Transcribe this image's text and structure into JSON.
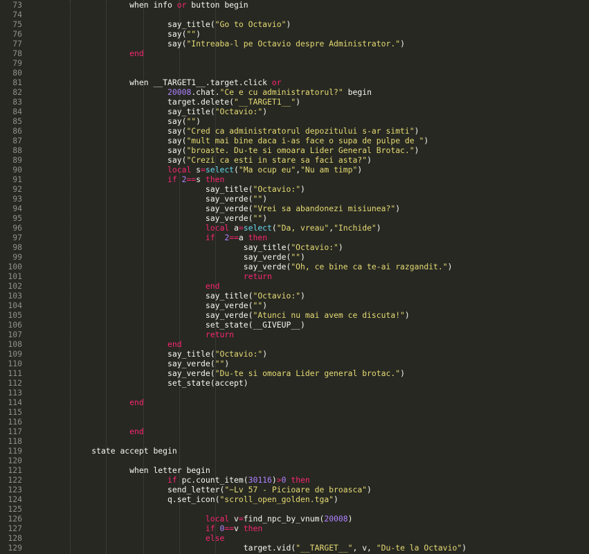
{
  "editor": {
    "lines": [
      {
        "n": "73",
        "t": [
          [
            "",
            "                    when info "
          ],
          [
            "kw",
            "or"
          ],
          [
            "",
            " button begin"
          ]
        ]
      },
      {
        "n": "74",
        "t": []
      },
      {
        "n": "75",
        "t": [
          [
            "",
            "                            say_title("
          ],
          [
            "str",
            "\"Go to Octavio\""
          ],
          [
            "",
            ")"
          ]
        ]
      },
      {
        "n": "76",
        "t": [
          [
            "",
            "                            say("
          ],
          [
            "str",
            "\"\""
          ],
          [
            "",
            ")"
          ]
        ]
      },
      {
        "n": "77",
        "t": [
          [
            "",
            "                            say("
          ],
          [
            "str",
            "\"Intreaba-l pe Octavio despre Administrator.\""
          ],
          [
            "",
            ")"
          ]
        ]
      },
      {
        "n": "78",
        "t": [
          [
            "kw",
            "                    end"
          ]
        ]
      },
      {
        "n": "79",
        "t": []
      },
      {
        "n": "80",
        "t": []
      },
      {
        "n": "81",
        "t": [
          [
            "",
            "                    when __TARGET1__.target.click "
          ],
          [
            "kw",
            "or"
          ]
        ]
      },
      {
        "n": "82",
        "t": [
          [
            "num",
            "                            20008"
          ],
          [
            "",
            ".chat."
          ],
          [
            "str",
            "\"Ce e cu administratorul?\""
          ],
          [
            "",
            " begin"
          ]
        ]
      },
      {
        "n": "83",
        "t": [
          [
            "",
            "                            target.delete("
          ],
          [
            "str",
            "\"__TARGET1__\""
          ],
          [
            "",
            ")"
          ]
        ]
      },
      {
        "n": "84",
        "t": [
          [
            "",
            "                            say_title("
          ],
          [
            "str",
            "\"Octavio:\""
          ],
          [
            "",
            ")"
          ]
        ]
      },
      {
        "n": "85",
        "t": [
          [
            "",
            "                            say("
          ],
          [
            "str",
            "\"\""
          ],
          [
            "",
            ")"
          ]
        ]
      },
      {
        "n": "86",
        "t": [
          [
            "",
            "                            say("
          ],
          [
            "str",
            "\"Cred ca administratorul depozitului s-ar simti\""
          ],
          [
            "",
            ")"
          ]
        ]
      },
      {
        "n": "87",
        "t": [
          [
            "",
            "                            say("
          ],
          [
            "str",
            "\"mult mai bine daca i-as face o supa de pulpe de \""
          ],
          [
            "",
            ")"
          ]
        ]
      },
      {
        "n": "88",
        "t": [
          [
            "",
            "                            say("
          ],
          [
            "str",
            "\"broaste. Du-te si omoara Lider General Brotac.\""
          ],
          [
            "",
            ")"
          ]
        ]
      },
      {
        "n": "89",
        "t": [
          [
            "",
            "                            say("
          ],
          [
            "str",
            "\"Crezi ca esti in stare sa faci asta?\""
          ],
          [
            "",
            ")"
          ]
        ]
      },
      {
        "n": "90",
        "t": [
          [
            "kw",
            "                            local"
          ],
          [
            "",
            " s"
          ],
          [
            "kw",
            "="
          ],
          [
            "fn",
            "select"
          ],
          [
            "",
            "("
          ],
          [
            "str",
            "\"Ma ocup eu\""
          ],
          [
            "",
            ","
          ],
          [
            "str",
            "\"Nu am timp\""
          ],
          [
            "",
            ")"
          ]
        ]
      },
      {
        "n": "91",
        "t": [
          [
            "kw",
            "                            if"
          ],
          [
            "",
            " "
          ],
          [
            "num",
            "2"
          ],
          [
            "kw",
            "=="
          ],
          [
            "",
            "s "
          ],
          [
            "kw",
            "then"
          ]
        ]
      },
      {
        "n": "92",
        "t": [
          [
            "",
            "                                    say_title("
          ],
          [
            "str",
            "\"Octavio:\""
          ],
          [
            "",
            ")"
          ]
        ]
      },
      {
        "n": "93",
        "t": [
          [
            "",
            "                                    say_verde("
          ],
          [
            "str",
            "\"\""
          ],
          [
            "",
            ")"
          ]
        ]
      },
      {
        "n": "94",
        "t": [
          [
            "",
            "                                    say_verde("
          ],
          [
            "str",
            "\"Vrei sa abandonezi misiunea?\""
          ],
          [
            "",
            ")"
          ]
        ]
      },
      {
        "n": "95",
        "t": [
          [
            "",
            "                                    say_verde("
          ],
          [
            "str",
            "\"\""
          ],
          [
            "",
            ")"
          ]
        ]
      },
      {
        "n": "96",
        "t": [
          [
            "kw",
            "                                    local"
          ],
          [
            "",
            " a"
          ],
          [
            "kw",
            "="
          ],
          [
            "fn",
            "select"
          ],
          [
            "",
            "("
          ],
          [
            "str",
            "\"Da, vreau\""
          ],
          [
            "",
            ","
          ],
          [
            "str",
            "\"Inchide\""
          ],
          [
            "",
            ")"
          ]
        ]
      },
      {
        "n": "97",
        "t": [
          [
            "kw",
            "                                    if"
          ],
          [
            "",
            "  "
          ],
          [
            "num",
            "2"
          ],
          [
            "kw",
            "=="
          ],
          [
            "",
            "a "
          ],
          [
            "kw",
            "then"
          ]
        ]
      },
      {
        "n": "98",
        "t": [
          [
            "",
            "                                            say_title("
          ],
          [
            "str",
            "\"Octavio:\""
          ],
          [
            "",
            ")"
          ]
        ]
      },
      {
        "n": "99",
        "t": [
          [
            "",
            "                                            say_verde("
          ],
          [
            "str",
            "\"\""
          ],
          [
            "",
            ")"
          ]
        ]
      },
      {
        "n": "100",
        "t": [
          [
            "",
            "                                            say_verde("
          ],
          [
            "str",
            "\"Oh, ce bine ca te-ai razgandit.\""
          ],
          [
            "",
            ")"
          ]
        ]
      },
      {
        "n": "101",
        "t": [
          [
            "kw",
            "                                            return"
          ]
        ]
      },
      {
        "n": "102",
        "t": [
          [
            "kw",
            "                                    end"
          ]
        ]
      },
      {
        "n": "103",
        "t": [
          [
            "",
            "                                    say_title("
          ],
          [
            "str",
            "\"Octavio:\""
          ],
          [
            "",
            ")"
          ]
        ]
      },
      {
        "n": "104",
        "t": [
          [
            "",
            "                                    say_verde("
          ],
          [
            "str",
            "\"\""
          ],
          [
            "",
            ")"
          ]
        ]
      },
      {
        "n": "105",
        "t": [
          [
            "",
            "                                    say_verde("
          ],
          [
            "str",
            "\"Atunci nu mai avem ce discuta!\""
          ],
          [
            "",
            ")"
          ]
        ]
      },
      {
        "n": "106",
        "t": [
          [
            "",
            "                                    set_state(__GIVEUP__)"
          ]
        ]
      },
      {
        "n": "107",
        "t": [
          [
            "kw",
            "                                    return"
          ]
        ]
      },
      {
        "n": "108",
        "t": [
          [
            "kw",
            "                            end"
          ]
        ]
      },
      {
        "n": "109",
        "t": [
          [
            "",
            "                            say_title("
          ],
          [
            "str",
            "\"Octavio:\""
          ],
          [
            "",
            ")"
          ]
        ]
      },
      {
        "n": "110",
        "t": [
          [
            "",
            "                            say_verde("
          ],
          [
            "str",
            "\"\""
          ],
          [
            "",
            ")"
          ]
        ]
      },
      {
        "n": "111",
        "t": [
          [
            "",
            "                            say_verde("
          ],
          [
            "str",
            "\"Du-te si omoara Lider general brotac.\""
          ],
          [
            "",
            ")"
          ]
        ]
      },
      {
        "n": "112",
        "t": [
          [
            "",
            "                            set_state(accept)"
          ]
        ]
      },
      {
        "n": "113",
        "t": []
      },
      {
        "n": "114",
        "t": [
          [
            "kw",
            "                    end"
          ]
        ]
      },
      {
        "n": "115",
        "t": []
      },
      {
        "n": "116",
        "t": []
      },
      {
        "n": "117",
        "t": [
          [
            "kw",
            "                    end"
          ]
        ]
      },
      {
        "n": "118",
        "t": []
      },
      {
        "n": "119",
        "t": [
          [
            "",
            "            state accept begin"
          ]
        ]
      },
      {
        "n": "120",
        "t": []
      },
      {
        "n": "121",
        "t": [
          [
            "",
            "                    when letter begin"
          ]
        ]
      },
      {
        "n": "122",
        "t": [
          [
            "kw",
            "                            if"
          ],
          [
            "",
            " pc.count_item("
          ],
          [
            "num",
            "30116"
          ],
          [
            "",
            ")"
          ],
          [
            "kw",
            ">"
          ],
          [
            "num",
            "0"
          ],
          [
            "",
            " "
          ],
          [
            "kw",
            "then"
          ]
        ]
      },
      {
        "n": "123",
        "t": [
          [
            "",
            "                            send_letter("
          ],
          [
            "str",
            "\"~Lv 57 - Picioare de broasca\""
          ],
          [
            "",
            ")"
          ]
        ]
      },
      {
        "n": "124",
        "t": [
          [
            "",
            "                            q.set_icon("
          ],
          [
            "str",
            "\"scroll_open_golden.tga\""
          ],
          [
            "",
            ")"
          ]
        ]
      },
      {
        "n": "125",
        "t": []
      },
      {
        "n": "126",
        "t": [
          [
            "kw",
            "                                    local"
          ],
          [
            "",
            " v"
          ],
          [
            "kw",
            "="
          ],
          [
            "",
            "find_npc_by_vnum("
          ],
          [
            "num",
            "20008"
          ],
          [
            "",
            ")"
          ]
        ]
      },
      {
        "n": "127",
        "t": [
          [
            "kw",
            "                                    if"
          ],
          [
            "",
            " "
          ],
          [
            "num",
            "0"
          ],
          [
            "kw",
            "=="
          ],
          [
            "",
            "v "
          ],
          [
            "kw",
            "then"
          ]
        ]
      },
      {
        "n": "128",
        "t": [
          [
            "kw",
            "                                    else"
          ]
        ]
      },
      {
        "n": "129",
        "t": [
          [
            "",
            "                                            target.vid("
          ],
          [
            "str",
            "\"__TARGET__\""
          ],
          [
            "",
            ", v, "
          ],
          [
            "str",
            "\"Du-te la Octavio\""
          ],
          [
            "",
            ")"
          ]
        ]
      }
    ]
  }
}
